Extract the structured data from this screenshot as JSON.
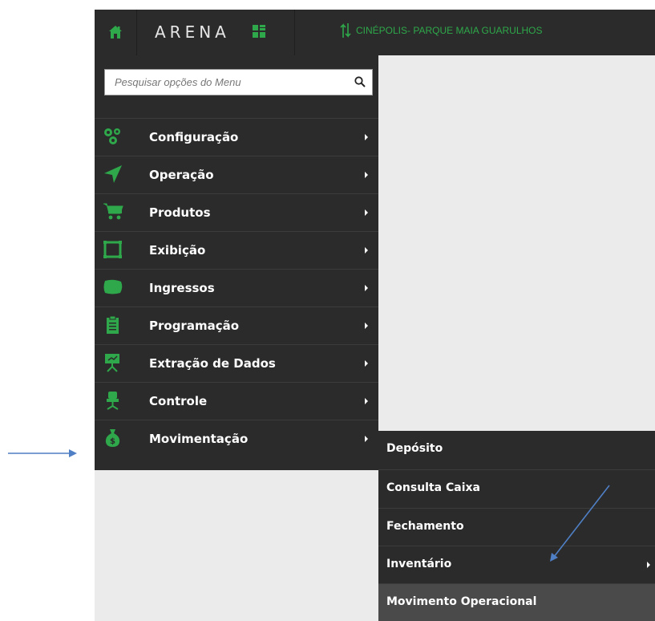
{
  "header": {
    "logo_text": "ARENA",
    "cinema_name": "CINÉPOLIS- PARQUE MAIA GUARULHOS",
    "icons": [
      "home-icon",
      "arena-logo-mark",
      "switch-arrows-icon"
    ]
  },
  "search": {
    "placeholder": "Pesquisar opções do Menu",
    "icon": "search-icon"
  },
  "menu": {
    "items": [
      {
        "label": "Configuração",
        "icon": "gears-icon"
      },
      {
        "label": "Operação",
        "icon": "location-arrow-icon"
      },
      {
        "label": "Produtos",
        "icon": "cart-icon"
      },
      {
        "label": "Exibição",
        "icon": "screen-frame-icon"
      },
      {
        "label": "Ingressos",
        "icon": "ticket-icon"
      },
      {
        "label": "Programação",
        "icon": "clipboard-icon"
      },
      {
        "label": "Extração de Dados",
        "icon": "presentation-board-icon"
      },
      {
        "label": "Controle",
        "icon": "chair-icon"
      },
      {
        "label": "Movimentação",
        "icon": "money-bag-icon"
      }
    ]
  },
  "submenu": {
    "items": [
      {
        "label": "Depósito"
      },
      {
        "label": "Consulta Caixa"
      },
      {
        "label": "Fechamento"
      },
      {
        "label": "Inventário"
      },
      {
        "label": "Movimento Operacional"
      }
    ]
  },
  "colors": {
    "bar": "#2b2b2b",
    "accent_green": "#2ea84a",
    "annotation_arrow": "#4f7fc4",
    "content_bg": "#ebebeb"
  }
}
